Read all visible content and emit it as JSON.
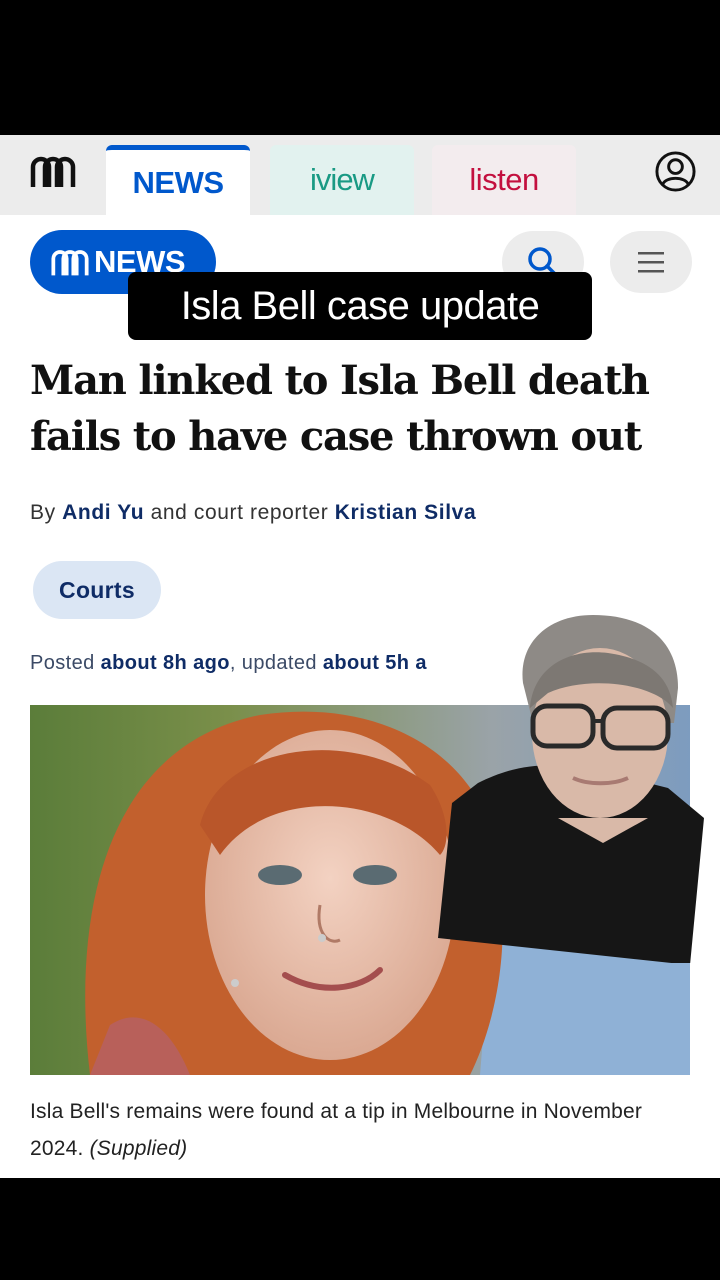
{
  "topnav": {
    "tabs": [
      {
        "label": "NEWS"
      },
      {
        "label": "iview"
      },
      {
        "label": "listen"
      }
    ]
  },
  "header": {
    "logo_text": "NEWS"
  },
  "overlay": {
    "caption": "Isla Bell case update"
  },
  "article": {
    "headline": "Man linked to Isla Bell death fails to have case thrown out",
    "byline": {
      "prefix": "By",
      "author1": "Andi Yu",
      "middle": "and court reporter",
      "author2": "Kristian Silva"
    },
    "tag": "Courts",
    "posted": {
      "prefix": "Posted",
      "posted_time": "about 8h ago",
      "updated_prefix": ", updated",
      "updated_time": "about 5h a"
    },
    "image_caption": "Isla Bell's remains were found at a tip in Melbourne in November 2024.",
    "image_credit": "(Supplied)"
  },
  "colors": {
    "abc_blue": "#0058cc",
    "iview_teal": "#199a84",
    "listen_red": "#c3103f",
    "link_navy": "#0f2c66"
  }
}
